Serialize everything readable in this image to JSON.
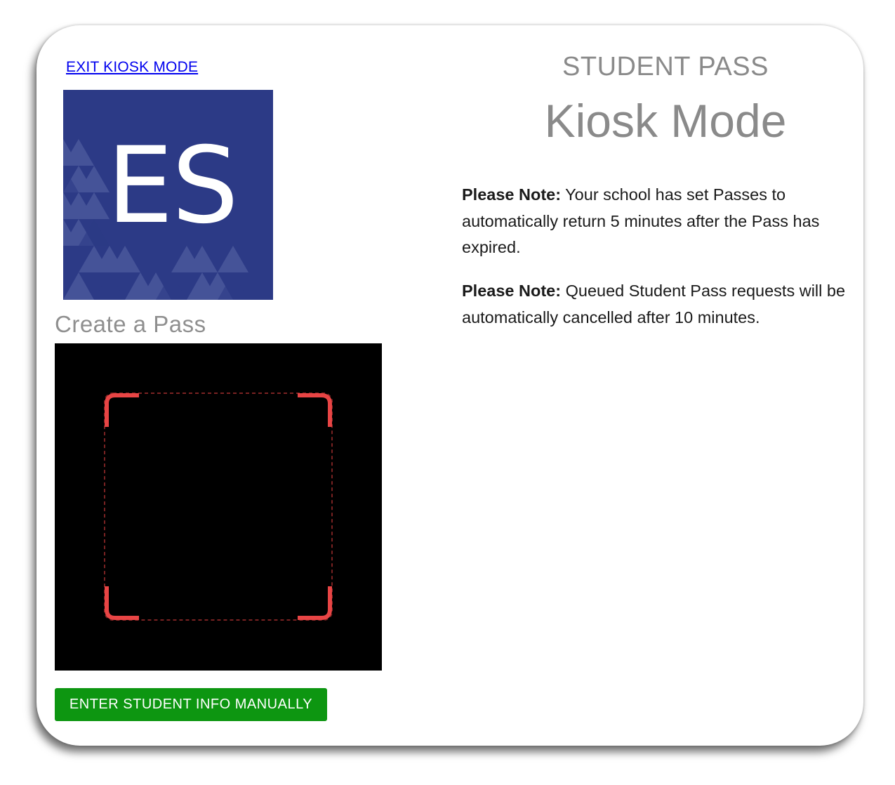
{
  "kiosk": {
    "exit_label": "EXIT KIOSK MODE",
    "logo_text": "ES",
    "create_title": "Create a Pass",
    "manual_button": "ENTER STUDENT INFO MANUALLY"
  },
  "header": {
    "app_name": "STUDENT PASS",
    "title": "Kiosk Mode"
  },
  "notes": [
    {
      "label": "Please Note:",
      "text": " Your school has set Passes to automatically return 5 minutes after the Pass has expired."
    },
    {
      "label": "Please Note:",
      "text": " Queued Student Pass requests will be automatically cancelled after 10 minutes."
    }
  ],
  "colors": {
    "logo_background": "#2c3a86",
    "scanner_background": "#000000",
    "scanner_corners": "#e84545",
    "button_background": "#0d9611",
    "link": "#0000ee"
  },
  "icons": {
    "scanner": "qr-scan-frame-icon"
  }
}
